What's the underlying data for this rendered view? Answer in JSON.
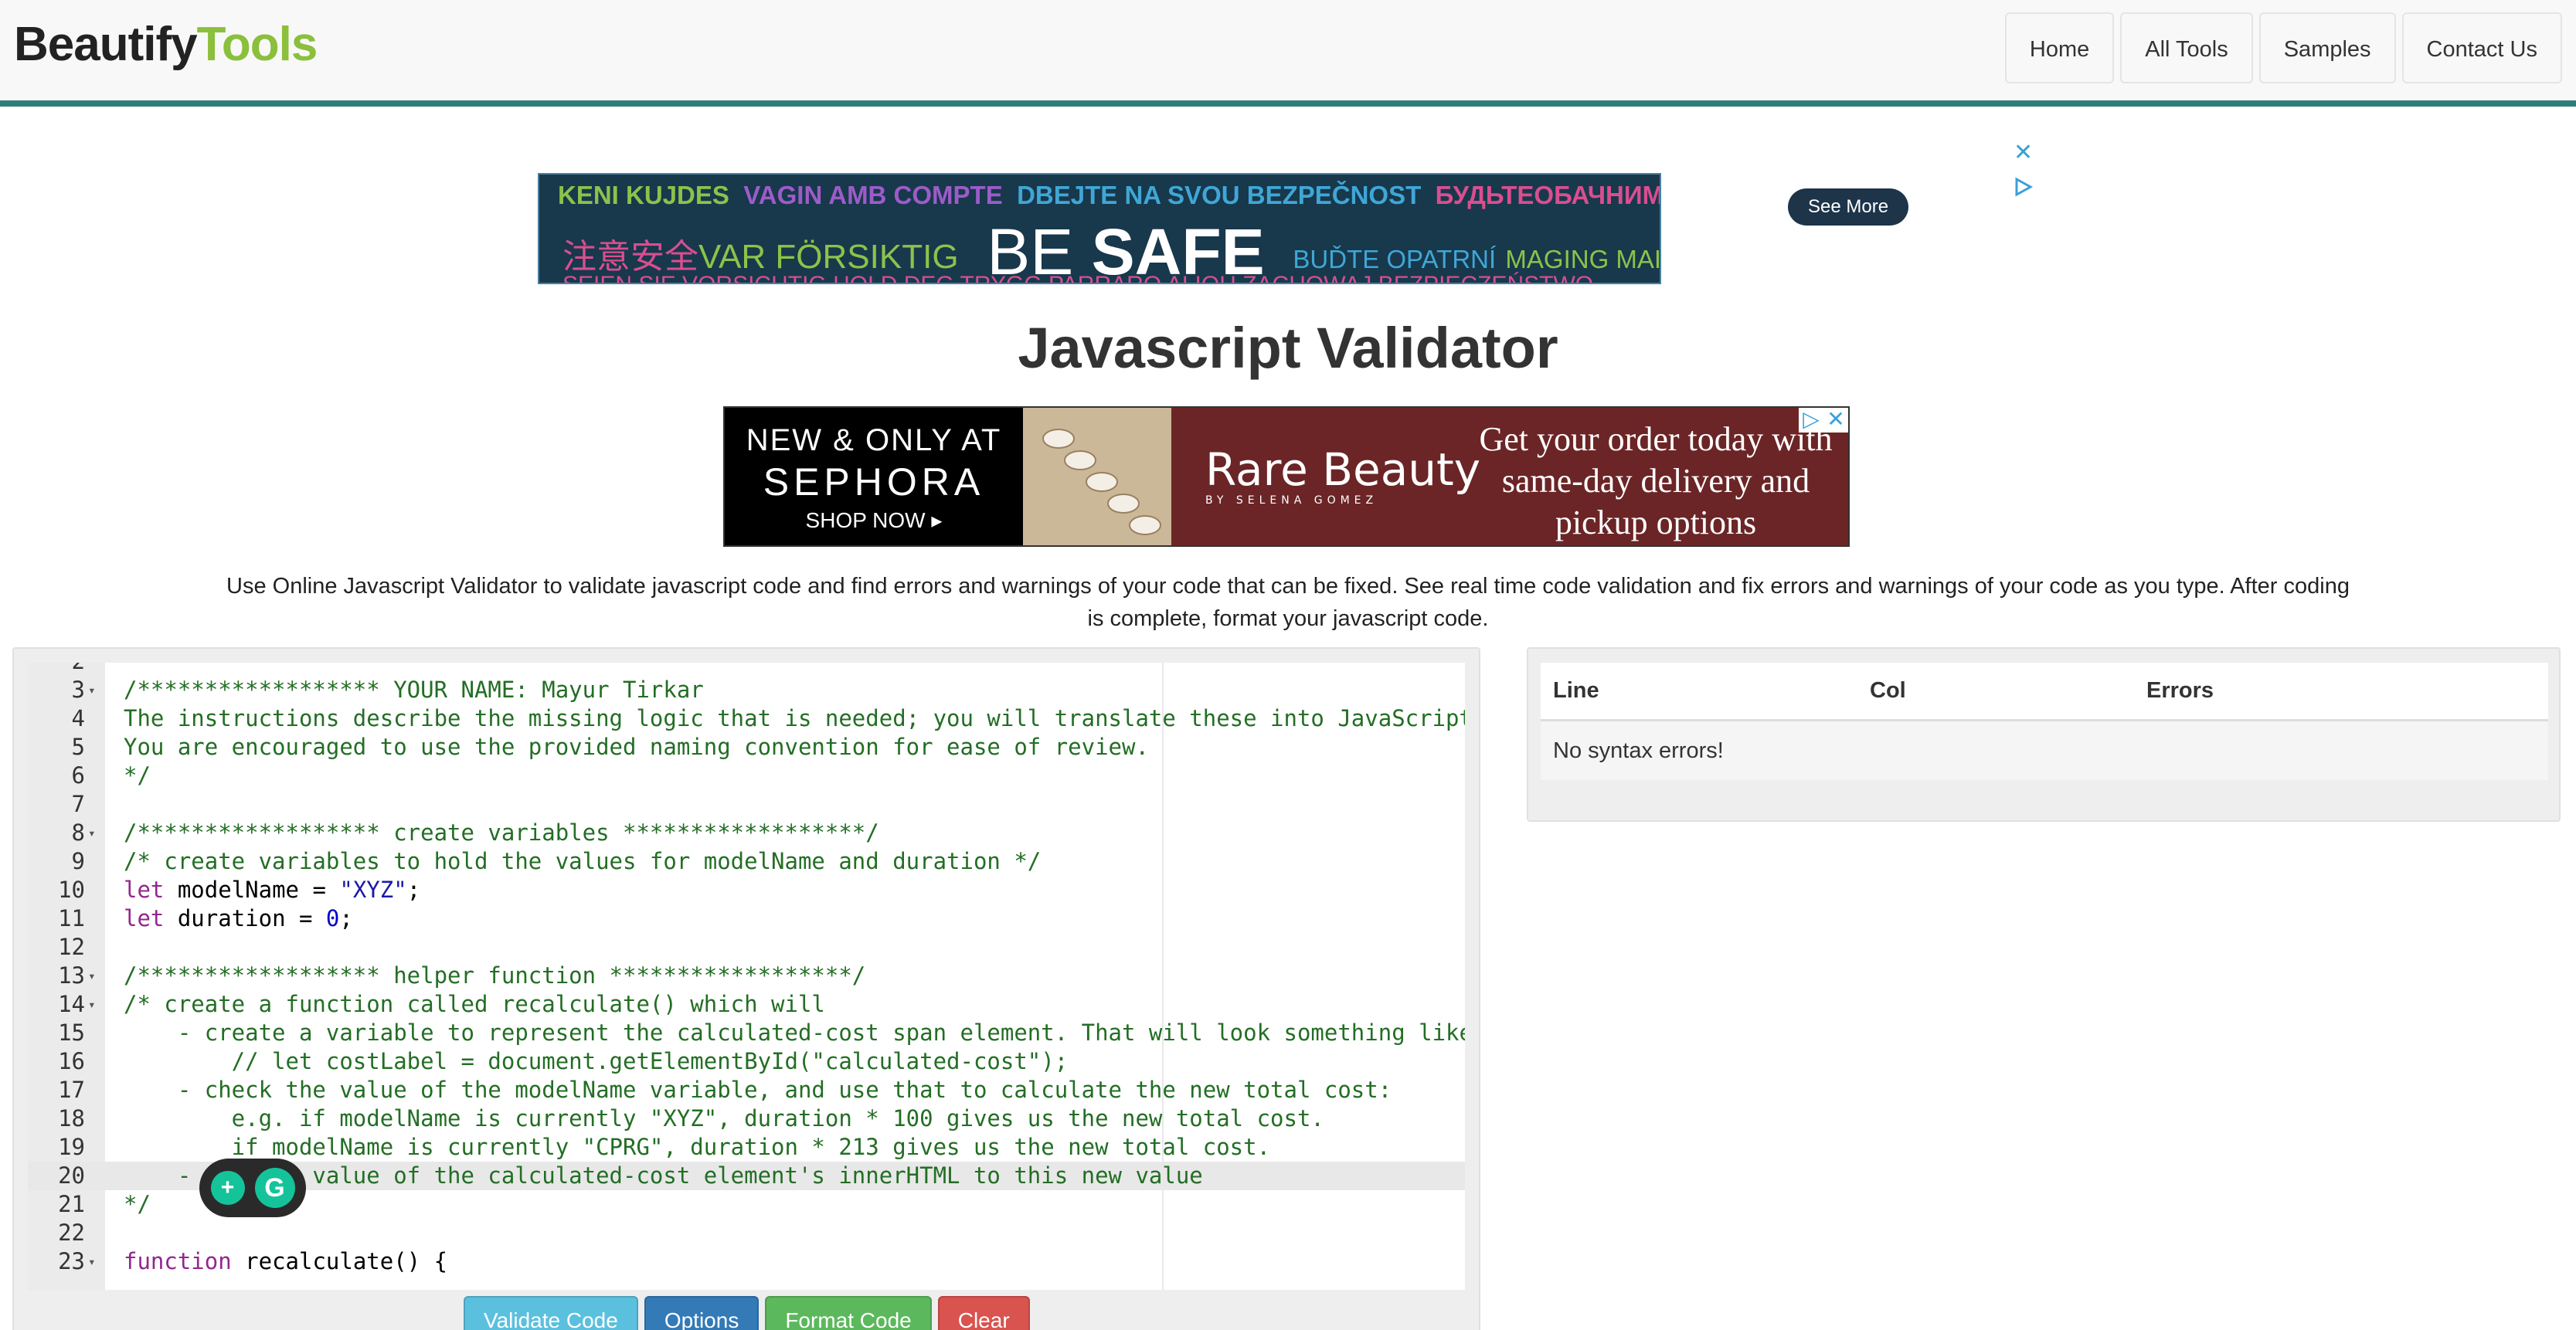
{
  "brand": {
    "part1": "Beautify",
    "part2": "Tools"
  },
  "nav": [
    "Home",
    "All Tools",
    "Samples",
    "Contact Us"
  ],
  "ad_top": {
    "row1": [
      {
        "text": "KENI KUJDES",
        "color": "#8bc34a"
      },
      {
        "text": "VAGIN AMB COMPTE",
        "color": "#9c5cc9"
      },
      {
        "text": "DBEJTE NA SVOU BEZPEČNOST",
        "color": "#3fa7d6"
      },
      {
        "text": "БУДЬТЕОБАЧНИМИ",
        "color": "#d94e8f"
      }
    ],
    "row2_left": [
      {
        "text": "注意安全",
        "color": "#d94e8f"
      },
      {
        "text": "VAR FÖRSIKTIG",
        "color": "#8bc34a"
      }
    ],
    "be": "BE",
    "safe": "SAFE",
    "row2_right": [
      {
        "text": "BUĎTE OPATRNÍ",
        "color": "#3fa7d6"
      },
      {
        "text": "MAGING MAINGAT",
        "color": "#8bc34a"
      }
    ],
    "row3": "SEIEN SIE VORSICHTIG  HOLD DEG TRYGG  PARRARO ALIOH  ZACHOWAJ BEZPIECZEŃSTWO",
    "see_more": "See More"
  },
  "title": "Javascript Validator",
  "ad_sephora": {
    "line1": "NEW & ONLY AT",
    "line2": "SEPHORA",
    "line3": "SHOP NOW ▸",
    "brand": "Rare Beauty",
    "brand_sub": "BY SELENA GOMEZ",
    "tagline": "Get your order today with same-day delivery and pickup options"
  },
  "intro": "Use Online Javascript Validator to validate javascript code and find errors and warnings of your code that can be fixed. See real time code validation and fix errors and warnings of your code as you type. After coding is complete, format your javascript code.",
  "editor": {
    "lines": [
      {
        "n": "2",
        "fold": false
      },
      {
        "n": "3",
        "fold": true
      },
      {
        "n": "4",
        "fold": false
      },
      {
        "n": "5",
        "fold": false
      },
      {
        "n": "6",
        "fold": false
      },
      {
        "n": "7",
        "fold": false
      },
      {
        "n": "8",
        "fold": true
      },
      {
        "n": "9",
        "fold": false
      },
      {
        "n": "10",
        "fold": false
      },
      {
        "n": "11",
        "fold": false
      },
      {
        "n": "12",
        "fold": false
      },
      {
        "n": "13",
        "fold": true
      },
      {
        "n": "14",
        "fold": true
      },
      {
        "n": "15",
        "fold": false
      },
      {
        "n": "16",
        "fold": false
      },
      {
        "n": "17",
        "fold": false
      },
      {
        "n": "18",
        "fold": false
      },
      {
        "n": "19",
        "fold": false
      },
      {
        "n": "20",
        "fold": false
      },
      {
        "n": "21",
        "fold": false
      },
      {
        "n": "22",
        "fold": false
      },
      {
        "n": "23",
        "fold": true
      }
    ],
    "code": {
      "l3": "/****************** YOUR NAME: Mayur Tirkar",
      "l4": "The instructions describe the missing logic that is needed; you will translate these into JavaScript in t",
      "l5": "You are encouraged to use the provided naming convention for ease of review.",
      "l6": "*/",
      "l8": "/****************** create variables ******************/",
      "l9": "/* create variables to hold the values for modelName and duration */",
      "l10_kw": "let",
      "l10_mid": " modelName = ",
      "l10_str": "\"XYZ\"",
      "l10_end": ";",
      "l11_kw": "let",
      "l11_mid": " duration = ",
      "l11_num": "0",
      "l11_end": ";",
      "l13": "/****************** helper function ******************/",
      "l14": "/* create a function called recalculate() which will",
      "l15": "    - create a variable to represent the calculated-cost span element. That will look something like:",
      "l16": "        // let costLabel = document.getElementById(\"calculated-cost\");",
      "l17": "    - check the value of the modelName variable, and use that to calculate the new total cost:",
      "l18": "        e.g. if modelName is currently \"XYZ\", duration * 100 gives us the new total cost.",
      "l19": "        if modelName is currently \"CPRG\", duration * 213 gives us the new total cost.",
      "l20": "    - set the value of the calculated-cost element's innerHTML to this new value",
      "l21": "*/",
      "l23_kw": "function",
      "l23_rest": " recalculate() {"
    }
  },
  "buttons": {
    "validate": "Validate Code",
    "options": "Options",
    "format": "Format Code",
    "clear": "Clear"
  },
  "results": {
    "headers": [
      "Line",
      "Col",
      "Errors"
    ],
    "message": "No syntax errors!"
  }
}
